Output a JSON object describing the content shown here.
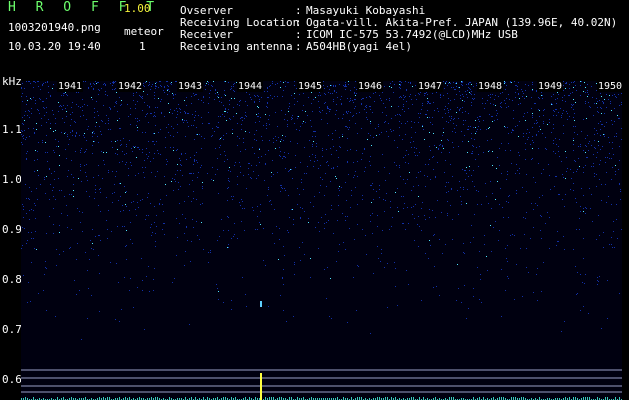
{
  "header": {
    "app_title": "H R O F F T",
    "version": "1.00",
    "filename": "1003201940.png",
    "datetime": "10.03.20 19:40",
    "meteor_label": "meteor",
    "meteor_count": "1"
  },
  "station_info": [
    {
      "label": "Ovserver",
      "value": "Masayuki Kobayashi"
    },
    {
      "label": "Receiving Location",
      "value": "Ogata-vill. Akita-Pref. JAPAN (139.96E, 40.02N)"
    },
    {
      "label": "Receiver",
      "value": "ICOM IC-575 53.7492(@LCD)MHz USB"
    },
    {
      "label": "Receiving antenna",
      "value": "A504HB(yagi 4el)"
    }
  ],
  "spectrogram": {
    "y_unit": "kHz",
    "y_ticks": [
      "1.1",
      "1.0",
      "0.9",
      "0.8",
      "0.7",
      "0.6"
    ],
    "x_ticks": [
      "1941",
      "1942",
      "1943",
      "1944",
      "1945",
      "1946",
      "1947",
      "1948",
      "1949",
      "1950"
    ],
    "colors": {
      "background": "#000010",
      "noise_low": "#1230a8",
      "noise_high": "#4fe6ff",
      "guide_lines": "#9aa0c8",
      "meteor": "#ffff40"
    }
  }
}
